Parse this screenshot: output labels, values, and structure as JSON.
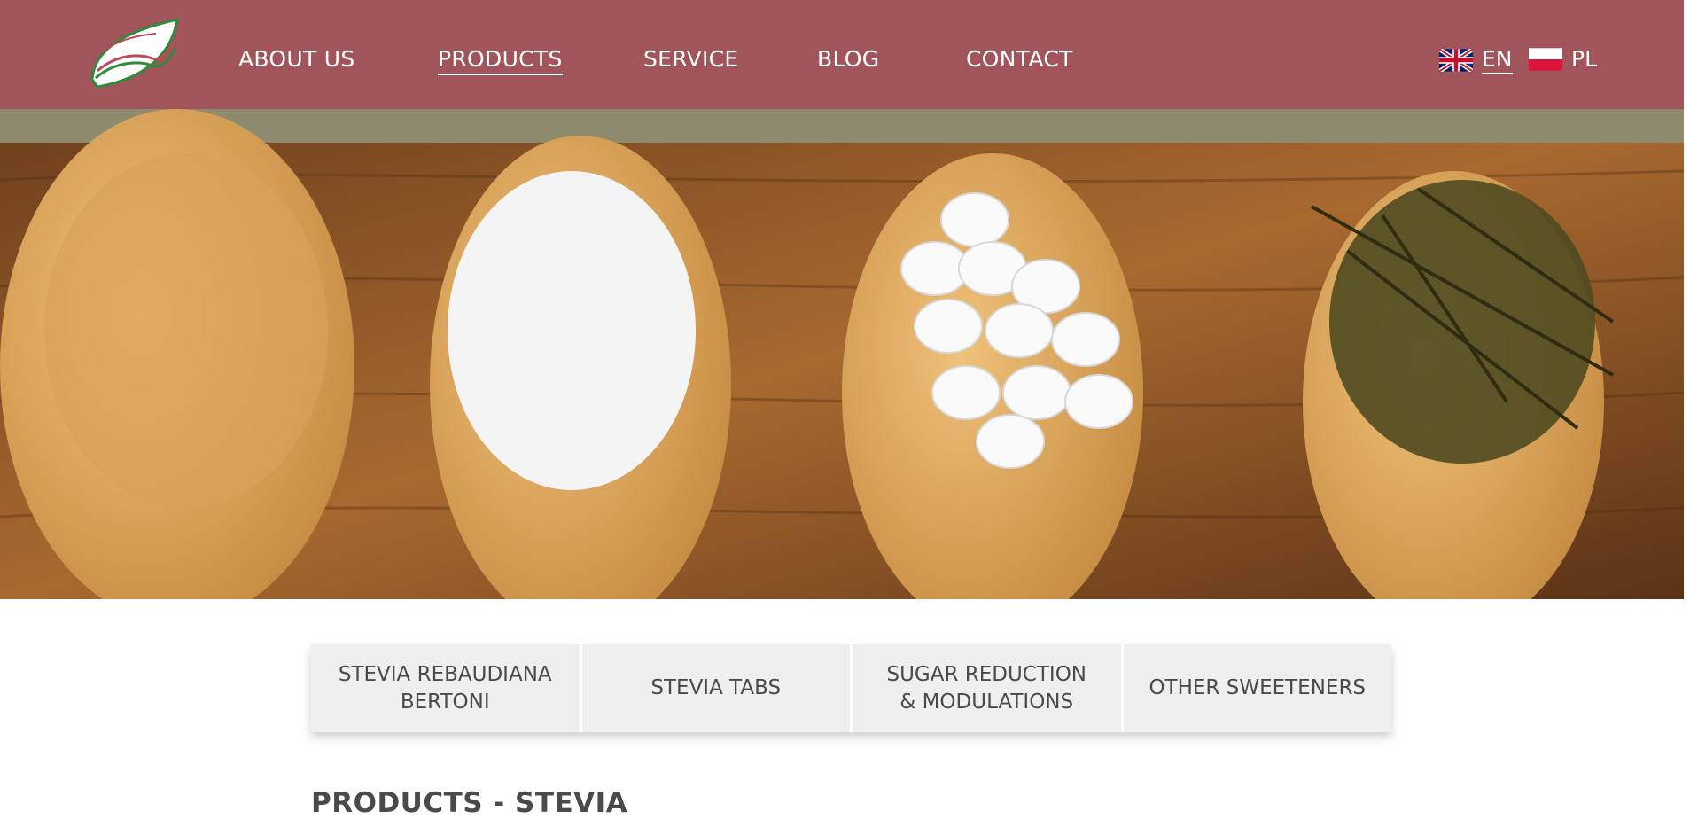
{
  "header": {
    "logo_icon": "leaf-logo-icon",
    "nav": [
      {
        "label": "ABOUT US",
        "active": false
      },
      {
        "label": "PRODUCTS",
        "active": true
      },
      {
        "label": "SERVICE",
        "active": false
      },
      {
        "label": "BLOG",
        "active": false
      },
      {
        "label": "CONTACT",
        "active": false
      }
    ],
    "languages": [
      {
        "code": "EN",
        "flag": "uk-flag-icon",
        "active": true
      },
      {
        "code": "PL",
        "flag": "poland-flag-icon",
        "active": false
      }
    ]
  },
  "hero": {
    "image_subject": "wooden spoons with stevia liquid, powder, tabs and leaves"
  },
  "subnav": [
    {
      "label": "STEVIA REBAUDIANA\nBERTONI"
    },
    {
      "label": "STEVIA TABS"
    },
    {
      "label": "SUGAR REDUCTION\n& MODULATIONS"
    },
    {
      "label": "OTHER SWEETENERS"
    }
  ],
  "main": {
    "title": "PRODUCTS - STEVIA"
  },
  "colors": {
    "header_bg": "#a1555a",
    "subnav_bg": "#efefef",
    "text_dark": "#4a4a4a"
  }
}
